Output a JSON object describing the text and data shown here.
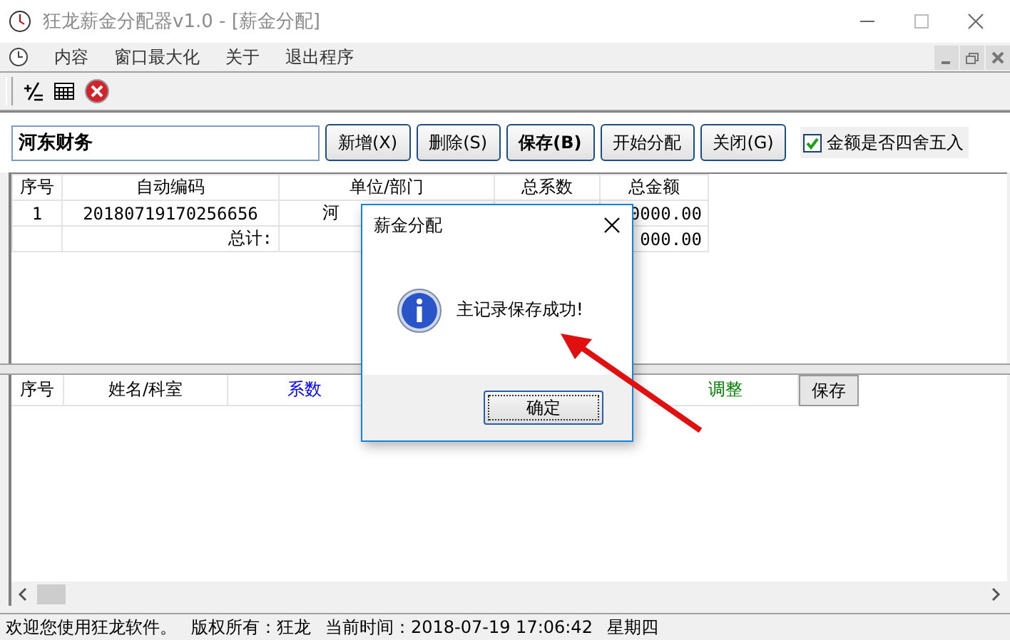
{
  "window": {
    "title": "狂龙薪金分配器v1.0 - [薪金分配]"
  },
  "menu": [
    {
      "label": "内容"
    },
    {
      "label": "窗口最大化"
    },
    {
      "label": "关于"
    },
    {
      "label": "退出程序"
    }
  ],
  "form": {
    "name_value": "河东财务",
    "buttons": [
      {
        "label": "新增(X)",
        "bold": false
      },
      {
        "label": "删除(S)",
        "bold": false
      },
      {
        "label": "保存(B)",
        "bold": true
      },
      {
        "label": "开始分配",
        "bold": false
      },
      {
        "label": "关闭(G)",
        "bold": false
      }
    ],
    "round_checkbox": {
      "label": "金额是否四舍五入",
      "checked": true
    }
  },
  "upper_table": {
    "columns": [
      "序号",
      "自动编码",
      "单位/部门",
      "总系数",
      "总金额"
    ],
    "row": {
      "no": "1",
      "code": "20180719170256656",
      "unit": "河",
      "amount": "0000.00"
    },
    "total": {
      "label": "总计:",
      "amount": "000.00"
    }
  },
  "lower_table": {
    "columns": [
      {
        "label": "序号",
        "color": "#000000"
      },
      {
        "label": "姓名/科室",
        "color": "#000000"
      },
      {
        "label": "系数",
        "color": "#0000ff"
      },
      {
        "label": "调整",
        "color": "#008000"
      }
    ],
    "save_button": "保存"
  },
  "status_bar": [
    "欢迎您使用狂龙软件。",
    "版权所有：狂龙",
    "当前时间：2018-07-19 17:06:42",
    "星期四"
  ],
  "dialog": {
    "title": "薪金分配",
    "message": "主记录保存成功!",
    "button": "确定"
  }
}
